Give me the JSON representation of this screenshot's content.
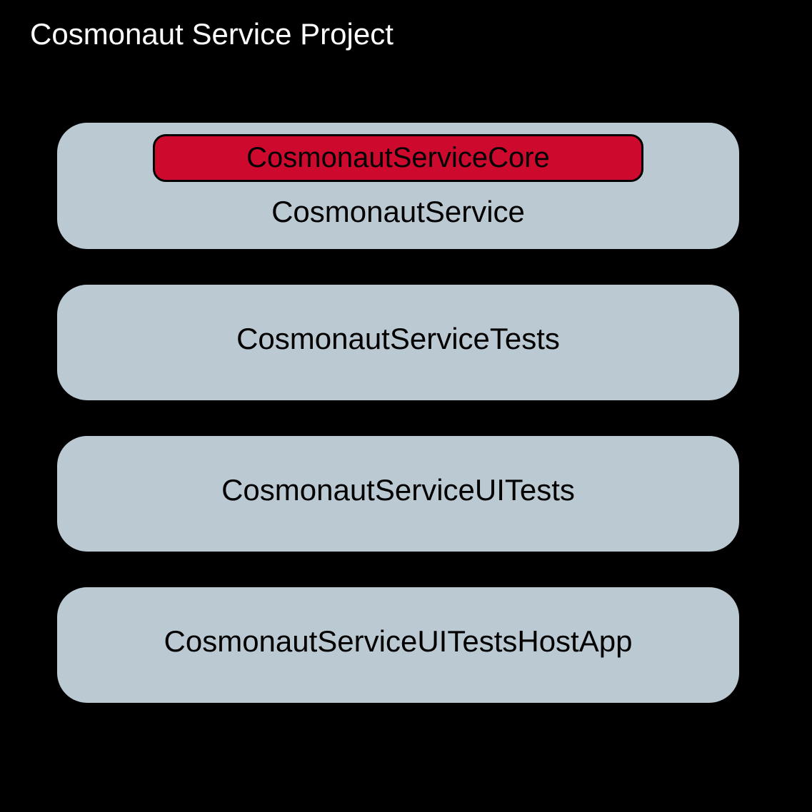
{
  "diagram": {
    "title": "Cosmonaut Service Project",
    "modules": [
      {
        "label": "CosmonautService",
        "core": "CosmonautServiceCore"
      },
      {
        "label": "CosmonautServiceTests"
      },
      {
        "label": "CosmonautServiceUITests"
      },
      {
        "label": "CosmonautServiceUITestsHostApp"
      }
    ],
    "colors": {
      "background": "#000000",
      "moduleBackground": "#bbc9d3",
      "coreBackground": "#cd0a2e",
      "titleText": "#ffffff",
      "moduleText": "#000000"
    }
  }
}
